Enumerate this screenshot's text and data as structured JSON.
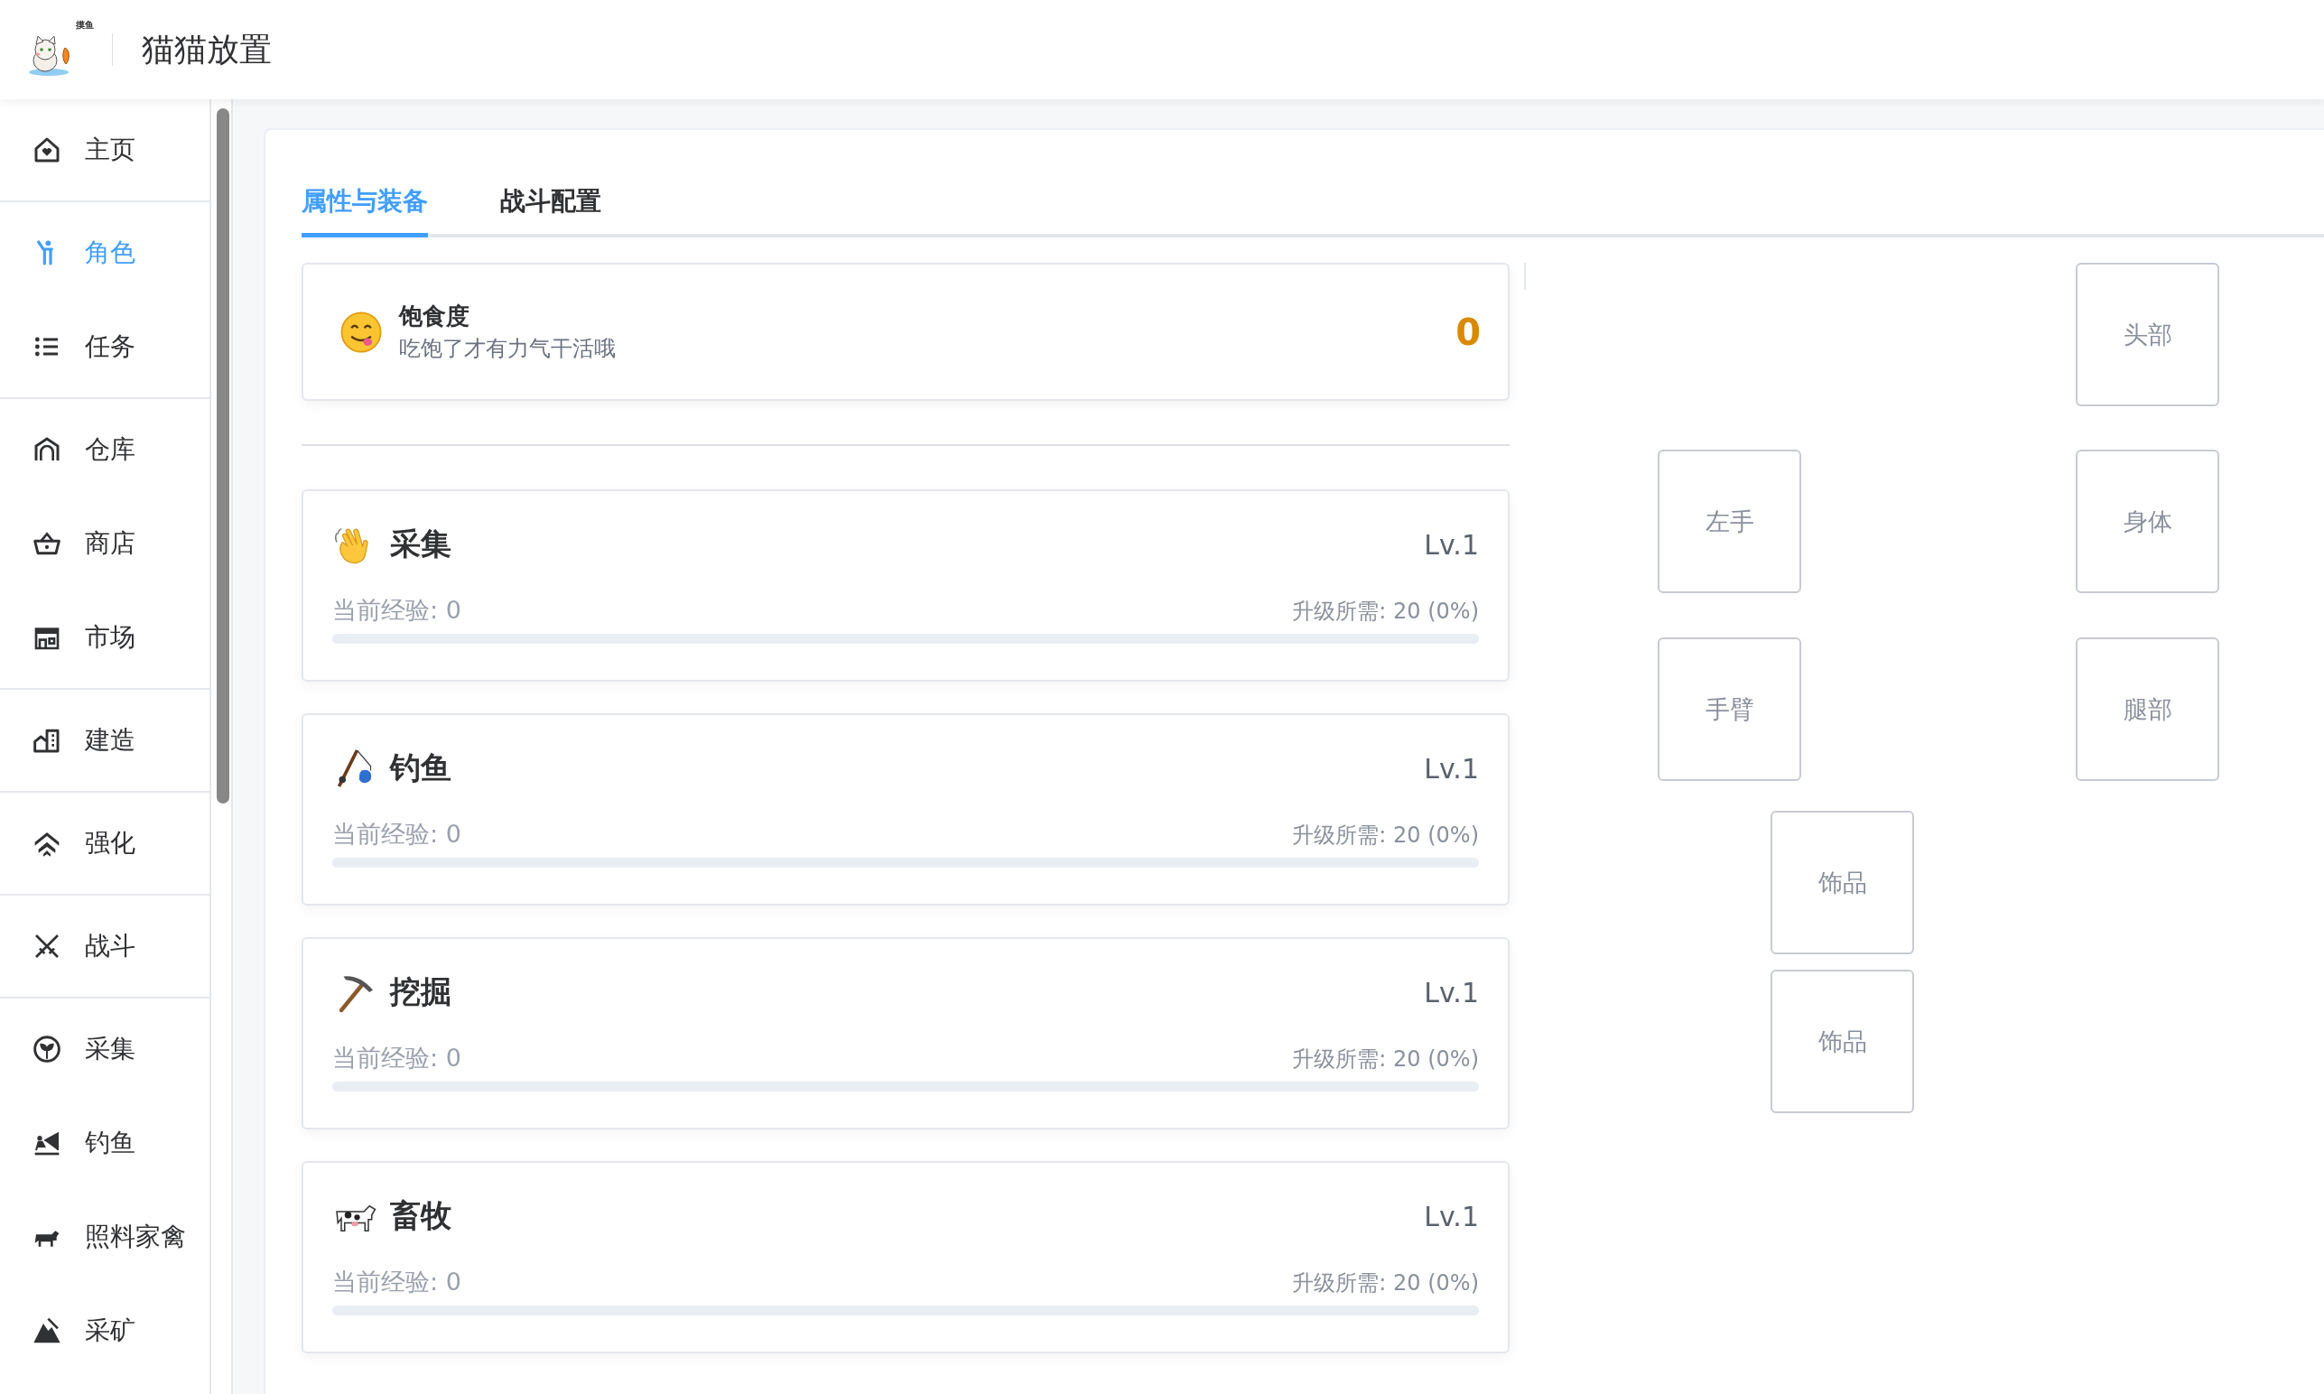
{
  "header": {
    "logo_text": "摸鱼",
    "title": "猫猫放置"
  },
  "sidebar": {
    "groups": [
      {
        "items": [
          {
            "label": "主页",
            "selected": false
          }
        ]
      },
      {
        "items": [
          {
            "label": "角色",
            "selected": true
          },
          {
            "label": "任务",
            "selected": false
          }
        ]
      },
      {
        "items": [
          {
            "label": "仓库",
            "selected": false
          },
          {
            "label": "商店",
            "selected": false
          },
          {
            "label": "市场",
            "selected": false
          }
        ]
      },
      {
        "items": [
          {
            "label": "建造",
            "selected": false
          }
        ]
      },
      {
        "items": [
          {
            "label": "强化",
            "selected": false
          }
        ]
      },
      {
        "items": [
          {
            "label": "战斗",
            "selected": false
          }
        ]
      },
      {
        "items": [
          {
            "label": "采集",
            "selected": false
          },
          {
            "label": "钓鱼",
            "selected": false
          },
          {
            "label": "照料家禽",
            "selected": false
          },
          {
            "label": "采矿",
            "selected": false
          }
        ]
      }
    ]
  },
  "tabs": [
    {
      "label": "属性与装备",
      "selected": true
    },
    {
      "label": "战斗配置",
      "selected": false
    }
  ],
  "satiety": {
    "title": "饱食度",
    "subtitle": "吃饱了才有力气干活哦",
    "value": "0"
  },
  "skills": [
    {
      "name": "采集",
      "level_text": "Lv.1",
      "exp": "当前经验: 0",
      "next": "升级所需: 20 (0%)",
      "level": 0
    },
    {
      "name": "钓鱼",
      "level_text": "Lv.1",
      "exp": "当前经验: 0",
      "next": "升级所需: 20 (0%)",
      "level": 0
    },
    {
      "name": "挖掘",
      "level_text": "Lv.1",
      "exp": "当前经验: 0",
      "next": "升级所需: 20 (0%)",
      "level": 0
    },
    {
      "name": "畜牧",
      "level_text": "Lv.1",
      "exp": "当前经验: 0",
      "next": "升级所需: 20 (0%)",
      "level": 0
    }
  ],
  "equipment": [
    {
      "kind": "head",
      "label": "头部"
    },
    {
      "kind": "left_hand",
      "label": "左手"
    },
    {
      "kind": "body",
      "label": "身体"
    },
    {
      "kind": "arm",
      "label": "手臂"
    },
    {
      "kind": "legs",
      "label": "腿部"
    },
    {
      "kind": "accessory_1",
      "label": "饰品"
    },
    {
      "kind": "accessory_2",
      "label": "饰品"
    }
  ]
}
